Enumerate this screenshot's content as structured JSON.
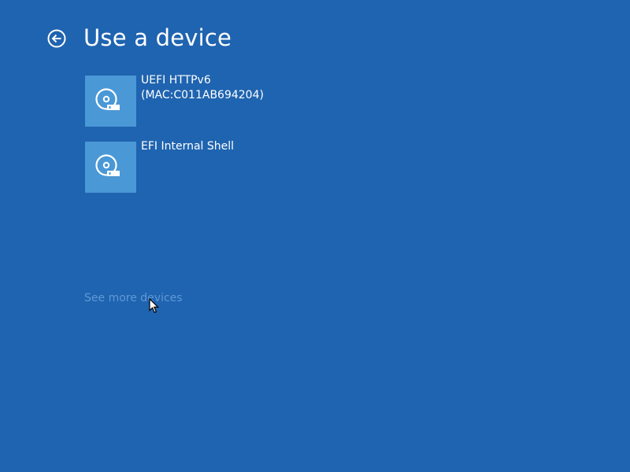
{
  "page": {
    "title": "Use a device",
    "back_icon": "back-arrow-circle-icon",
    "background_color": "#1f64b0"
  },
  "devices": [
    {
      "name_line1": "UEFI HTTPv6",
      "name_line2": "(MAC:C011AB694204)",
      "icon": "disk-drive-icon",
      "tile_color": "#4a98d6"
    },
    {
      "name_line1": "EFI Internal Shell",
      "name_line2": "",
      "icon": "disk-drive-icon",
      "tile_color": "#4a98d6"
    }
  ],
  "see_more": {
    "label": "See more devices",
    "color": "#5f98d6"
  },
  "cursor": {
    "icon": "mouse-pointer-icon"
  }
}
